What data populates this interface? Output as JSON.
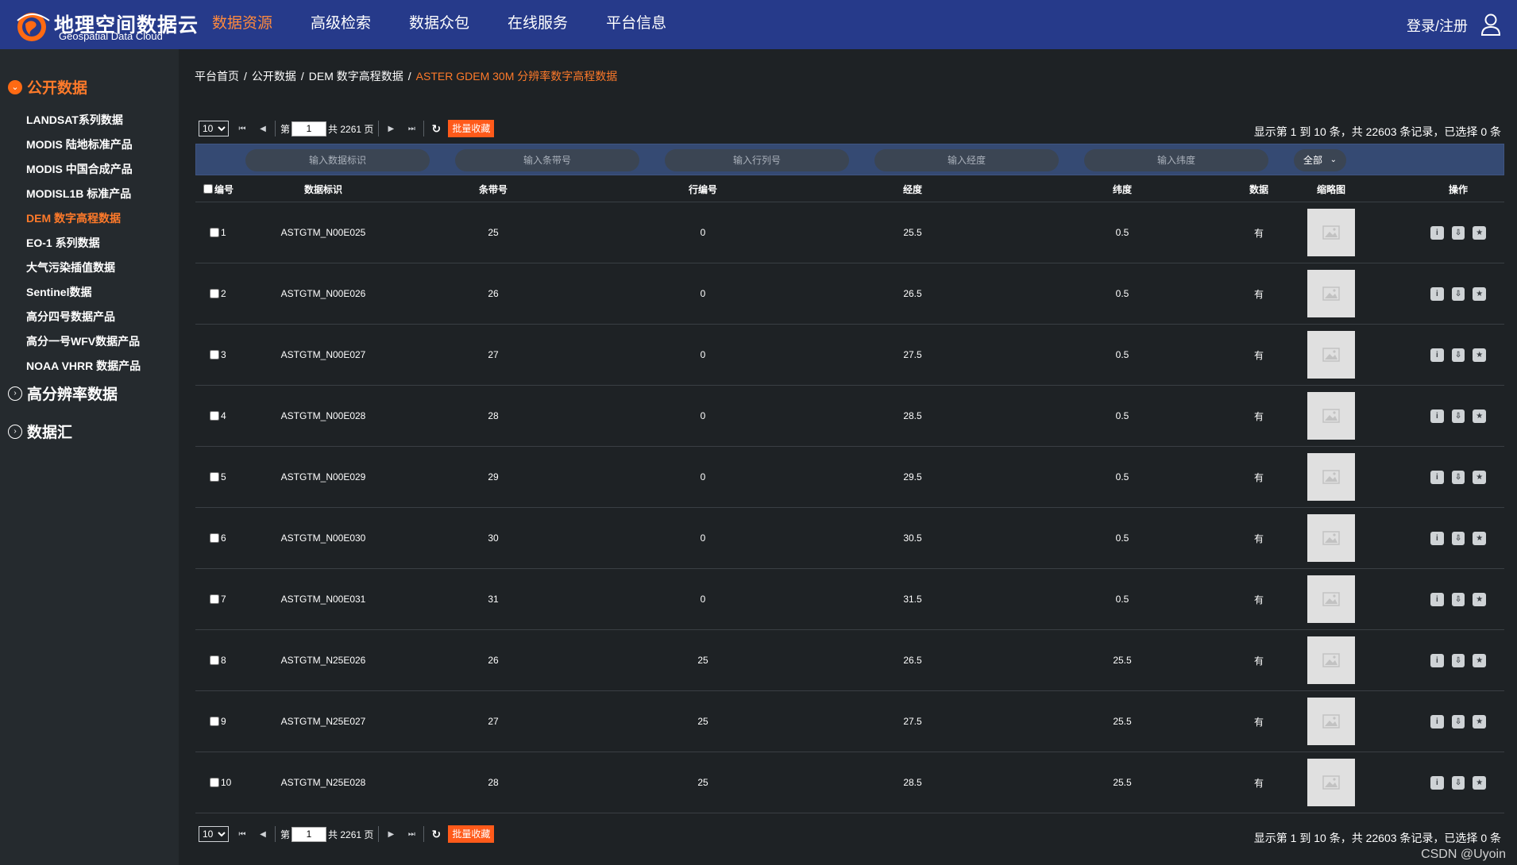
{
  "header": {
    "logo_cn": "地理空间数据云",
    "logo_en": "Geospatial Data Cloud",
    "nav": [
      "数据资源",
      "高级检索",
      "数据众包",
      "在线服务",
      "平台信息"
    ],
    "active_nav": "数据资源",
    "login": "登录/注册",
    "brand_color": "#263a8a",
    "accent_color": "#ff7a2a"
  },
  "sidebar": {
    "open_section": "公开数据",
    "items": [
      "LANDSAT系列数据",
      "MODIS 陆地标准产品",
      "MODIS 中国合成产品",
      "MODISL1B 标准产品",
      "DEM 数字高程数据",
      "EO-1 系列数据",
      "大气污染插值数据",
      "Sentinel数据",
      "高分四号数据产品",
      "高分一号WFV数据产品",
      "NOAA VHRR 数据产品"
    ],
    "active_item": "DEM 数字高程数据",
    "closed_sections": [
      "高分辨率数据",
      "数据汇"
    ]
  },
  "breadcrumb": [
    "平台首页",
    "公开数据",
    "DEM 数字高程数据"
  ],
  "breadcrumb_current": "ASTER GDEM 30M 分辨率数字高程数据",
  "pager": {
    "page_size": "10",
    "page_prefix": "第",
    "current_page": "1",
    "total_pages_text": "共 2261 页",
    "batch_label": "批量收藏",
    "info": "显示第 1 到 10 条，共 22603 条记录，已选择 0 条"
  },
  "filters": {
    "id_placeholder": "输入数据标识",
    "path_placeholder": "输入条带号",
    "row_placeholder": "输入行列号",
    "lon_placeholder": "输入经度",
    "lat_placeholder": "输入纬度",
    "select_value": "全部"
  },
  "table": {
    "columns": [
      "编号",
      "数据标识",
      "条带号",
      "行编号",
      "经度",
      "纬度",
      "数据",
      "缩略图",
      "操作"
    ],
    "rows": [
      {
        "num": "1",
        "id": "ASTGTM_N00E025",
        "path": "25",
        "row": "0",
        "lon": "25.5",
        "lat": "0.5",
        "data": "有"
      },
      {
        "num": "2",
        "id": "ASTGTM_N00E026",
        "path": "26",
        "row": "0",
        "lon": "26.5",
        "lat": "0.5",
        "data": "有"
      },
      {
        "num": "3",
        "id": "ASTGTM_N00E027",
        "path": "27",
        "row": "0",
        "lon": "27.5",
        "lat": "0.5",
        "data": "有"
      },
      {
        "num": "4",
        "id": "ASTGTM_N00E028",
        "path": "28",
        "row": "0",
        "lon": "28.5",
        "lat": "0.5",
        "data": "有"
      },
      {
        "num": "5",
        "id": "ASTGTM_N00E029",
        "path": "29",
        "row": "0",
        "lon": "29.5",
        "lat": "0.5",
        "data": "有"
      },
      {
        "num": "6",
        "id": "ASTGTM_N00E030",
        "path": "30",
        "row": "0",
        "lon": "30.5",
        "lat": "0.5",
        "data": "有"
      },
      {
        "num": "7",
        "id": "ASTGTM_N00E031",
        "path": "31",
        "row": "0",
        "lon": "31.5",
        "lat": "0.5",
        "data": "有"
      },
      {
        "num": "8",
        "id": "ASTGTM_N25E026",
        "path": "26",
        "row": "25",
        "lon": "26.5",
        "lat": "25.5",
        "data": "有"
      },
      {
        "num": "9",
        "id": "ASTGTM_N25E027",
        "path": "27",
        "row": "25",
        "lon": "27.5",
        "lat": "25.5",
        "data": "有"
      },
      {
        "num": "10",
        "id": "ASTGTM_N25E028",
        "path": "28",
        "row": "25",
        "lon": "28.5",
        "lat": "25.5",
        "data": "有"
      }
    ],
    "action_icons": [
      "info-icon",
      "download-icon",
      "favorite-star-icon"
    ]
  },
  "watermark": "CSDN @Uyoin"
}
